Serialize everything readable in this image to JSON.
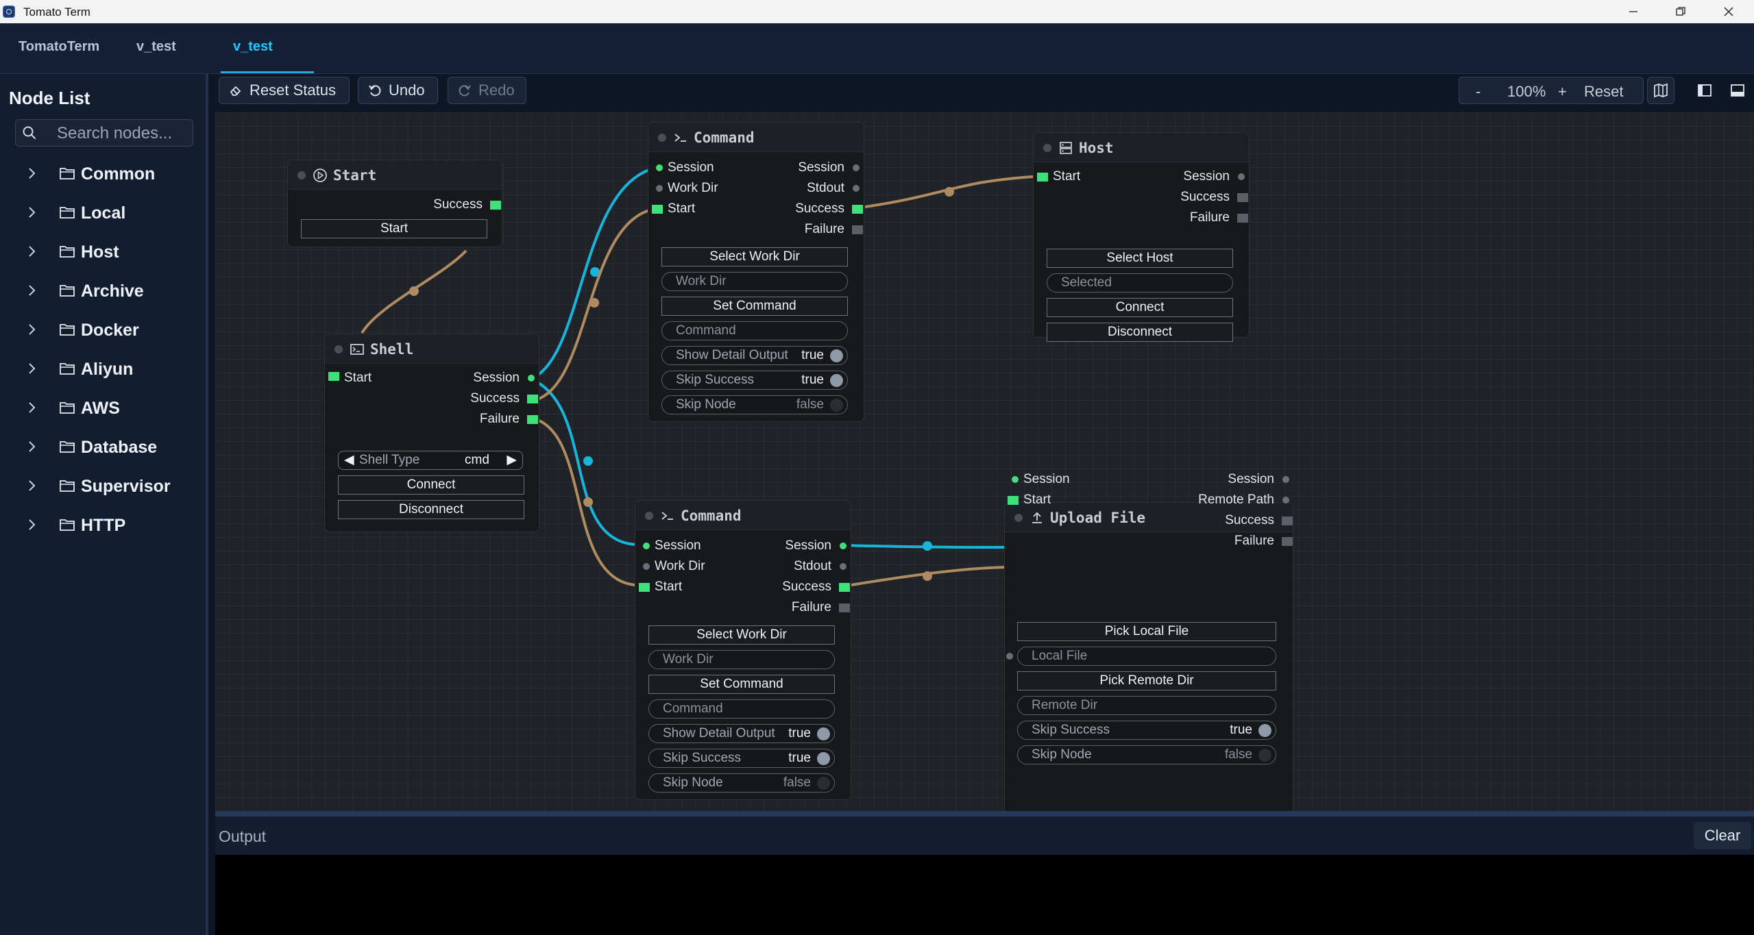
{
  "window": {
    "title": "Tomato Term"
  },
  "tabs": [
    {
      "label": "TomatoTerm"
    },
    {
      "label": "v_test"
    },
    {
      "label": "v_test",
      "active": true
    }
  ],
  "sidebar": {
    "heading": "Node List",
    "search_placeholder": "Search nodes...",
    "folders": [
      {
        "label": "Common"
      },
      {
        "label": "Local"
      },
      {
        "label": "Host"
      },
      {
        "label": "Archive"
      },
      {
        "label": "Docker"
      },
      {
        "label": "Aliyun"
      },
      {
        "label": "AWS"
      },
      {
        "label": "Database"
      },
      {
        "label": "Supervisor"
      },
      {
        "label": "HTTP"
      }
    ]
  },
  "toolbar": {
    "reset_status": "Reset Status",
    "undo": "Undo",
    "redo": "Redo",
    "zoom_out": "-",
    "zoom_level": "100%",
    "zoom_in": "+",
    "zoom_reset": "Reset"
  },
  "nodes": {
    "start": {
      "title": "Start",
      "out_success": "Success",
      "button": "Start"
    },
    "shell": {
      "title": "Shell",
      "in_start": "Start",
      "out_session": "Session",
      "out_success": "Success",
      "out_failure": "Failure",
      "shell_type_label": "Shell Type",
      "shell_type_value": "cmd",
      "connect": "Connect",
      "disconnect": "Disconnect"
    },
    "command1": {
      "title": "Command",
      "in_session": "Session",
      "in_workdir": "Work Dir",
      "in_start": "Start",
      "out_session": "Session",
      "out_stdout": "Stdout",
      "out_success": "Success",
      "out_failure": "Failure",
      "select_work_dir": "Select Work Dir",
      "work_dir_placeholder": "Work Dir",
      "set_command": "Set Command",
      "command_placeholder": "Command",
      "show_detail_output": "Show Detail Output",
      "show_detail_output_value": "true",
      "skip_success": "Skip Success",
      "skip_success_value": "true",
      "skip_node": "Skip Node",
      "skip_node_value": "false"
    },
    "host": {
      "title": "Host",
      "in_start": "Start",
      "out_session": "Session",
      "out_success": "Success",
      "out_failure": "Failure",
      "select_host": "Select Host",
      "selected_placeholder": "Selected",
      "connect": "Connect",
      "disconnect": "Disconnect"
    },
    "command2": {
      "title": "Command",
      "in_session": "Session",
      "in_workdir": "Work Dir",
      "in_start": "Start",
      "out_session": "Session",
      "out_stdout": "Stdout",
      "out_success": "Success",
      "out_failure": "Failure",
      "select_work_dir": "Select Work Dir",
      "work_dir_placeholder": "Work Dir",
      "set_command": "Set Command",
      "command_placeholder": "Command",
      "show_detail_output": "Show Detail Output",
      "show_detail_output_value": "true",
      "skip_success": "Skip Success",
      "skip_success_value": "true",
      "skip_node": "Skip Node",
      "skip_node_value": "false"
    },
    "upload": {
      "title": "Upload File",
      "in_session": "Session",
      "in_start": "Start",
      "out_session": "Session",
      "out_remote_path": "Remote Path",
      "out_success": "Success",
      "out_failure": "Failure",
      "pick_local_file": "Pick Local File",
      "local_file_placeholder": "Local File",
      "pick_remote_dir": "Pick Remote Dir",
      "remote_dir_placeholder": "Remote Dir",
      "skip_success": "Skip Success",
      "skip_success_value": "true",
      "skip_node": "Skip Node",
      "skip_node_value": "false"
    }
  },
  "colors": {
    "session_edge": "#18b4dc",
    "flow_edge": "#b08b62",
    "port_active": "#3ee07a",
    "tab_active": "#28c6ff"
  },
  "output": {
    "title": "Output",
    "clear": "Clear"
  }
}
